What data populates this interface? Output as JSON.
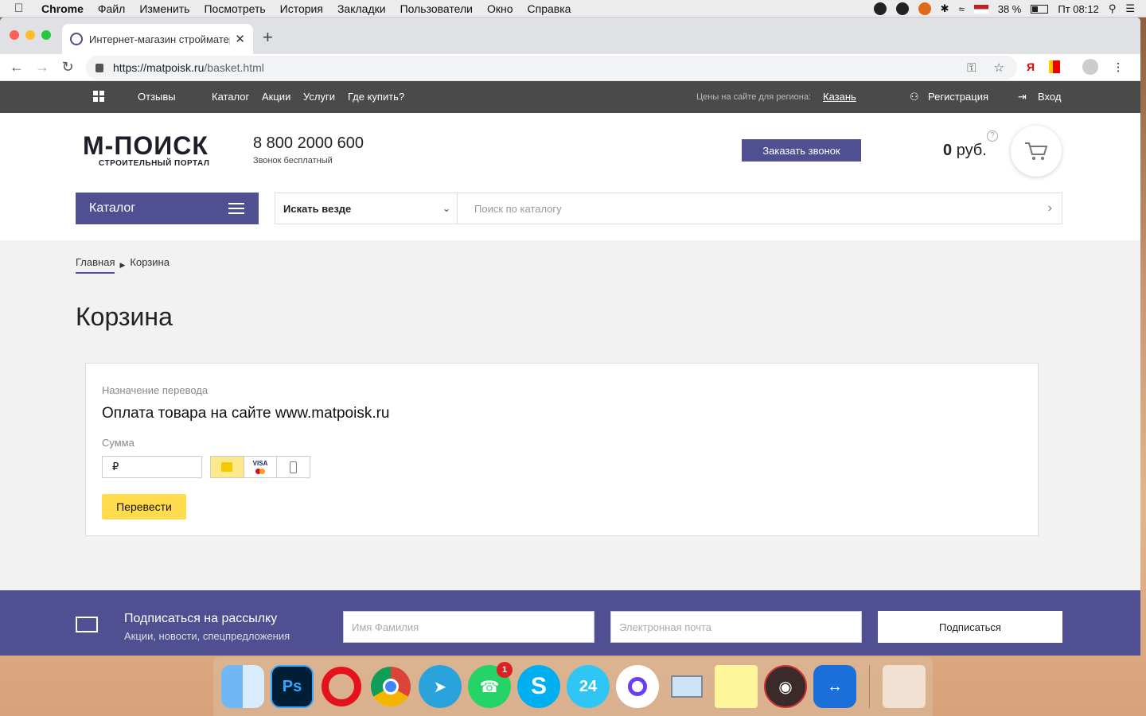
{
  "menubar": {
    "app": "Chrome",
    "items": [
      "Файл",
      "Изменить",
      "Посмотреть",
      "История",
      "Закладки",
      "Пользователи",
      "Окно",
      "Справка"
    ],
    "battery": "38 %",
    "clock": "Пт 08:12"
  },
  "browser": {
    "tab_title": "Интернет-магазин стройматериалов",
    "url_host": "https://matpoisk.ru",
    "url_path": "/basket.html"
  },
  "topnav": {
    "links": [
      "Отзывы",
      "Каталог",
      "Акции",
      "Услуги",
      "Где купить?"
    ],
    "region_label": "Цены на сайте для региона:",
    "region": "Казань",
    "register": "Регистрация",
    "login": "Вход"
  },
  "header": {
    "logo_main": "М-ПОИСК",
    "logo_sub": "СТРОИТЕЛЬНЫЙ ПОРТАЛ",
    "phone": "8 800 2000 600",
    "phone_note": "Звонок бесплатный",
    "callback": "Заказать звонок",
    "cart_amount": "0",
    "cart_currency": "руб.",
    "catalog_button": "Каталог",
    "scope": "Искать везде",
    "search_placeholder": "Поиск по каталогу"
  },
  "content": {
    "breadcrumb_home": "Главная",
    "breadcrumb_current": "Корзина",
    "page_title": "Корзина",
    "purpose_label": "Назначение перевода",
    "purpose": "Оплата товара на сайте www.matpoisk.ru",
    "amount_label": "Сумма",
    "currency_sign": "₽",
    "visa": "VISA",
    "pay_button": "Перевести"
  },
  "footer": {
    "title": "Подписаться на рассылку",
    "subtitle": "Акции, новости, спецпредложения",
    "name_placeholder": "Имя Фамилия",
    "email_placeholder": "Электронная почта",
    "subscribe": "Подписаться"
  },
  "dock": {
    "whatsapp_badge": "1",
    "bitrix": "24",
    "photoshop": "Ps"
  },
  "colors": {
    "brand": "#4f4f91",
    "pay": "#ffdb4d",
    "topbar": "#4a4a4a"
  }
}
